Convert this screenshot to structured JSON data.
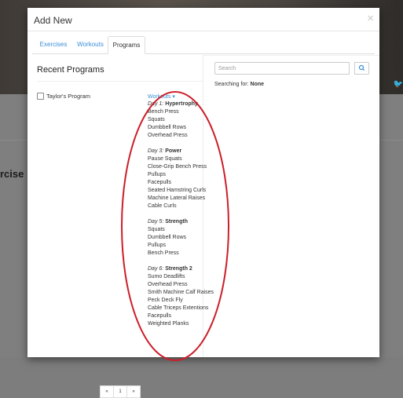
{
  "background": {
    "partial_heading": "rcise"
  },
  "modal": {
    "title": "Add New"
  },
  "tabs": [
    {
      "label": "Exercises"
    },
    {
      "label": "Workouts"
    },
    {
      "label": "Programs"
    }
  ],
  "recent": {
    "title": "Recent Programs",
    "program_name": "Taylor's Program"
  },
  "workouts_toggle": "Workouts",
  "days": [
    {
      "day_label": "Day 1:",
      "name": "Hypertrophy",
      "exercises": [
        "Bench Press",
        "Squats",
        "Dumbbell Rows",
        "Overhead Press"
      ]
    },
    {
      "day_label": "Day 3:",
      "name": "Power",
      "exercises": [
        "Pause Squats",
        "Close-Grip Bench Press",
        "Pullups",
        "Facepulls",
        "Seated Hamstring Curls",
        "Machine Lateral Raises",
        "Cable Curls"
      ]
    },
    {
      "day_label": "Day 5:",
      "name": "Strength",
      "exercises": [
        "Squats",
        "Dumbbell Rows",
        "Pullups",
        "Bench Press"
      ]
    },
    {
      "day_label": "Day 6:",
      "name": "Strength 2",
      "exercises": [
        "Sumo Deadlifts",
        "Overhead Press",
        "Smith Machine Calf Raises",
        "Peck Deck Fly",
        "Cable Triceps Extentions",
        "Facepulls",
        "Weighted Planks"
      ]
    }
  ],
  "pagination": {
    "prev": "«",
    "page": "1",
    "next": "»"
  },
  "search": {
    "placeholder": "Search",
    "status_label": "Searching for:",
    "status_value": "None"
  },
  "colors": {
    "annotation": "#cc1f2a",
    "link": "#3a8fd8"
  }
}
